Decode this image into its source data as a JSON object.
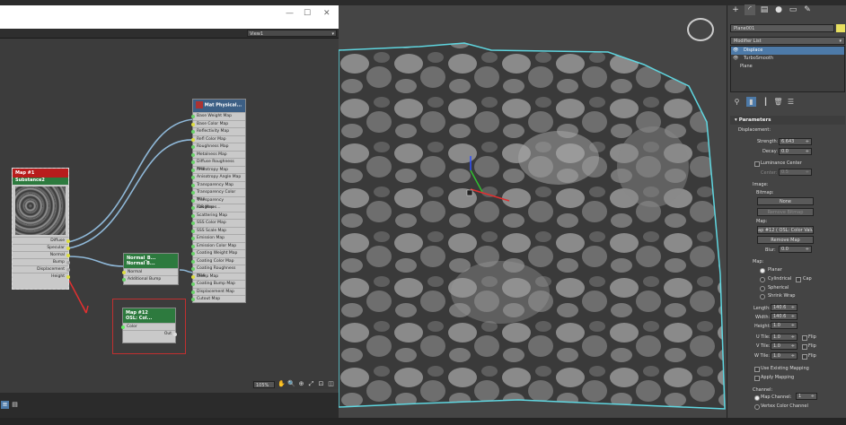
{
  "editor": {
    "view_label": "View1",
    "zoom": "105%",
    "nodes": {
      "substance": {
        "title1": "Map #1",
        "title2": "Substance2",
        "outputs": [
          "Diffuse",
          "Specular",
          "Normal",
          "Bump",
          "Displacement",
          "Height"
        ]
      },
      "physical": {
        "title1": "Mat",
        "title2": "Physical...",
        "slots": [
          "Base Weight Map",
          "Base Color Map",
          "Reflectivity Map",
          "Refl Color Map",
          "Roughness Map",
          "Metalness Map",
          "Diffuse Roughness Map",
          "Anisotropy Map",
          "Anisotropy Angle Map",
          "Transparency Map",
          "Transparency Color Map",
          "Transparency Roughnes...",
          "IOR Map",
          "Scattering Map",
          "SSS Color Map",
          "SSS Scale Map",
          "Emission Map",
          "Emission Color Map",
          "Coating Weight Map",
          "Coating Color Map",
          "Coating Roughness Map",
          "Bump Map",
          "Coating Bump Map",
          "Displacement Map",
          "Cutout Map"
        ]
      },
      "normal": {
        "title1": "Normal_B...",
        "title2": "Normal B...",
        "slots": [
          "Normal",
          "Additional Bump"
        ]
      },
      "osl": {
        "title1": "Map #12",
        "title2": "OSL: Col...",
        "input": "Color",
        "output": "Out"
      }
    }
  },
  "panel": {
    "object_name": "Plane001",
    "modifier_list": "Modifier List",
    "stack": [
      "Displace",
      "TurboSmooth",
      "Plane"
    ],
    "parameters_title": "Parameters",
    "displacement_label": "Displacement:",
    "strength_label": "Strength:",
    "strength_value": "6.643",
    "decay_label": "Decay:",
    "decay_value": "0.0",
    "luminance_center": "Luminance Center",
    "center_label": "Center:",
    "center_value": "0.5",
    "image_label": "Image:",
    "bitmap_label": "Bitmap:",
    "bitmap_value": "None",
    "remove_bitmap": "Remove Bitmap",
    "map_label": "Map:",
    "map_value": "ap #12 ( OSL: Color Value",
    "remove_map": "Remove Map",
    "blur_label": "Blur:",
    "blur_value": "0.0",
    "map2_label": "Map:",
    "planar": "Planar",
    "cylindrical": "Cylindrical",
    "cap": "Cap",
    "spherical": "Spherical",
    "shrink_wrap": "Shrink Wrap",
    "length_label": "Length:",
    "length_value": "140.6",
    "width_label": "Width:",
    "width_value": "140.6",
    "height_label": "Height:",
    "height_value": "1.0",
    "utile_label": "U Tile:",
    "utile_value": "1.0",
    "vtile_label": "V Tile:",
    "vtile_value": "1.0",
    "wtile_label": "W Tile:",
    "wtile_value": "1.0",
    "flip": "Flip",
    "use_existing": "Use Existing Mapping",
    "apply_mapping": "Apply Mapping",
    "channel_label": "Channel:",
    "map_channel": "Map Channel:",
    "map_channel_value": "1",
    "vertex_color": "Vertex Color Channel"
  }
}
